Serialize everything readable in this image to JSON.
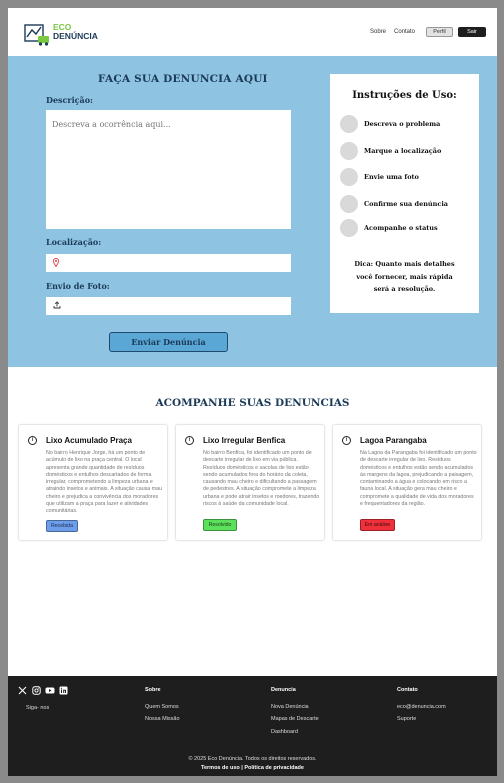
{
  "header": {
    "brand_line1": "ECO",
    "brand_line2": "DENÚNCIA",
    "nav": [
      "Sobre",
      "Contato"
    ],
    "profile_label": "Perfil",
    "logout_label": "Sair"
  },
  "form": {
    "title": "FAÇA SUA DENUNCIA AQUI",
    "description_label": "Descrição:",
    "description_placeholder": "Descreva a ocorrência aqui...",
    "location_label": "Localização:",
    "location_value": "",
    "photo_label": "Envio de Foto:",
    "submit_label": "Enviar Denúncia"
  },
  "instructions": {
    "title": "Instruções de Uso:",
    "steps": [
      "Descreva o problema",
      "Marque a localização",
      "Envie uma foto",
      "Confirme sua denúncia",
      "Acompanhe o status"
    ],
    "tip": "Dica: Quanto mais detalhes você fornecer, mais rápida será a resolução."
  },
  "tracking": {
    "title": "ACOMPANHE SUAS DENUNCIAS",
    "cards": [
      {
        "title": "Lixo Acumulado Praça",
        "description": "No bairro Henrique Jorge, há um ponto de acúmulo de lixo na praça central. O local apresenta grande quantidade de resíduos domésticos e entulhos descartados de forma irregular, comprometendo a limpeza urbana e atraindo insetos e animais. A situação causa mau cheiro e prejudica a convivência dos moradores que utilizam a praça para lazer e atividades comunitárias.",
        "status": "Recebida",
        "status_color": "#6d9eeb"
      },
      {
        "title": "Lixo Irregular Benfica",
        "description": "No bairro Benfica, foi identificado um ponto de descarte irregular de lixo em via pública. Resíduos domésticos e sacolas de lixo estão sendo acumulados fora do horário da coleta, causando mau cheiro e dificultando a passagem de pedestres. A situação compromete a limpeza urbana e pode atrair insetos e roedores, trazendo riscos à saúde da comunidade local.",
        "status": "Resolvido",
        "status_color": "#5de15d"
      },
      {
        "title": "Lagoa Parangaba",
        "description": "Na Lagoa da Parangaba foi identificado um ponto de descarte irregular de lixo. Resíduos domésticos e entulhos estão sendo acumulados às margens da lagoa, prejudicando a paisagem, contaminando a água e colocando em risco a fauna local. A situação gera mau cheiro e compromete a qualidade de vida dos moradores e frequentadores da região.",
        "status": "Em análise",
        "status_color": "#f0313b"
      }
    ]
  },
  "footer": {
    "social": [
      "x-icon",
      "instagram-icon",
      "youtube-icon",
      "linkedin-icon"
    ],
    "follow_label": "Siga- nos",
    "columns": [
      {
        "title": "Sobre",
        "links": [
          "Quem Somos",
          "Nossa Missão"
        ]
      },
      {
        "title": "Denuncia",
        "links": [
          "Nova Denúncia",
          "Mapas de Descarte",
          "Dashboard"
        ]
      },
      {
        "title": "Contato",
        "links": [
          "eco@denuncia.com",
          "Suporte"
        ]
      }
    ],
    "copyright": "© 2025 Eco Denúncia. Todos os direitos reservados.",
    "terms": "Termos de uso | Política de privacidade"
  },
  "colors": {
    "accent_blue": "#8ec3e2",
    "button_blue": "#5aa7d6",
    "navy": "#1b3a57",
    "brand_green": "#7ac943",
    "footer_bg": "#1e1e1e"
  }
}
